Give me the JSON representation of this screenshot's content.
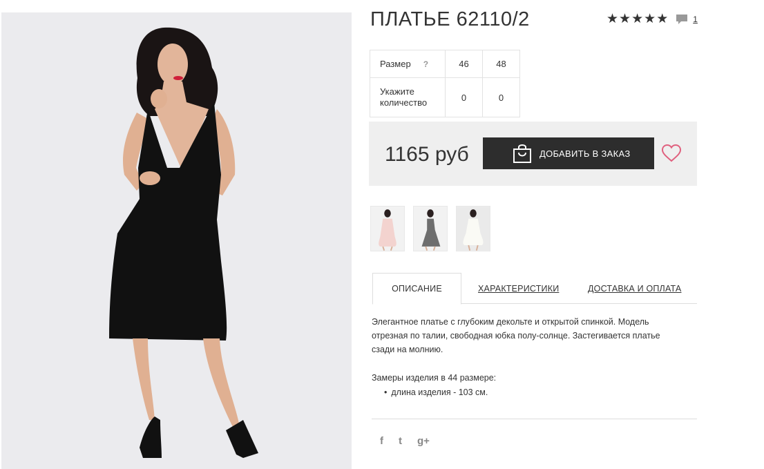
{
  "product": {
    "title": "ПЛАТЬЕ 62110/2",
    "rating_stars": 5,
    "review_count": "1"
  },
  "sizes": {
    "size_label": "Размер",
    "help_symbol": "?",
    "quantity_label": "Укажите количество",
    "columns": [
      {
        "size": "46",
        "quantity": "0"
      },
      {
        "size": "48",
        "quantity": "0"
      }
    ]
  },
  "purchase": {
    "price": "1165 руб",
    "add_button_label": "ДОБАВИТЬ В ЗАКАЗ"
  },
  "gallery": {
    "thumbnails": [
      {
        "name": "thumbnail-pink-dress",
        "color": "#f3d3cf"
      },
      {
        "name": "thumbnail-grey-dress",
        "color": "#6e6e6e"
      },
      {
        "name": "thumbnail-white-dress",
        "color": "#f5f5f0"
      }
    ]
  },
  "tabs": [
    {
      "label": "ОПИСАНИЕ",
      "active": true
    },
    {
      "label": "ХАРАКТЕРИСТИКИ",
      "active": false
    },
    {
      "label": "ДОСТАВКА И ОПЛАТА",
      "active": false
    }
  ],
  "description": {
    "text": "Элегантное платье с глубоким декольте и открытой спинкой. Модель отрезная по талии, свободная юбка полу-солнце. Застегивается платье сзади на молнию.",
    "measure_title": "Замеры изделия в 44 размере:",
    "measures": [
      "длина изделия - 103 см."
    ]
  },
  "social": {
    "facebook": "f",
    "twitter": "t",
    "google_plus": "g+"
  },
  "colors": {
    "dark": "#2d2d2d",
    "price_bar_bg": "#efefef",
    "heart": "#e0607e",
    "dress": "#111111"
  }
}
